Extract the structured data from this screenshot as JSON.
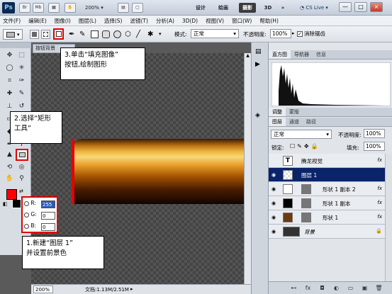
{
  "app": {
    "logo": "Ps",
    "zoom": "200%",
    "workspaces": [
      "设计",
      "绘画",
      "摄影",
      "3D"
    ],
    "active_workspace": "摄影",
    "cs_live": "CS Live",
    "window_buttons": [
      "—",
      "□",
      "×"
    ]
  },
  "menu": {
    "items": [
      "文件(F)",
      "编辑(E)",
      "图像(I)",
      "图层(L)",
      "选择(S)",
      "滤镜(T)",
      "分析(A)",
      "3D(D)",
      "视图(V)",
      "窗口(W)",
      "帮助(H)"
    ]
  },
  "options": {
    "mode_label": "模式:",
    "mode_value": "正常",
    "opacity_label": "不透明度:",
    "opacity_value": "100%",
    "antialias_label": "消除锯齿",
    "antialias_checked": true
  },
  "document": {
    "tab_label": "按钮背景",
    "status_zoom": "200%",
    "status_doc": "文档:1.13M/2.51M"
  },
  "colors": {
    "foreground": "#ff0000",
    "background": "#000000",
    "highlight": "#e00000"
  },
  "color_picker": {
    "r_label": "R:",
    "r_value": "255",
    "g_label": "G:",
    "g_value": "0",
    "b_label": "B:",
    "b_value": "0"
  },
  "panels": {
    "top_tabs": [
      "直方图",
      "导航器",
      "信息"
    ],
    "mid_tabs": [
      "调整",
      "蒙版"
    ],
    "layer_tabs": [
      "图层",
      "通道",
      "路径"
    ]
  },
  "layers": {
    "blend_mode": "正常",
    "opacity_label": "不透明度:",
    "opacity": "100%",
    "lock_label": "锁定:",
    "fill_label": "填充:",
    "fill": "100%",
    "rows": [
      {
        "name": "腾龙视觉",
        "type": "text",
        "fx": "fx",
        "selected": false
      },
      {
        "name": "图层 1",
        "type": "empty",
        "fx": "",
        "selected": true
      },
      {
        "name": "形状 1 副本 2",
        "type": "shape-white",
        "fx": "fx",
        "selected": false
      },
      {
        "name": "形状 1 副本",
        "type": "shape-black",
        "fx": "fx",
        "selected": false
      },
      {
        "name": "形状 1",
        "type": "shape-brown",
        "fx": "fx",
        "selected": false
      },
      {
        "name": "背景",
        "type": "background",
        "fx": "",
        "selected": false
      }
    ]
  },
  "callouts": {
    "step3_line1": "3.单击“填充图像”",
    "step3_line2": "按钮,绘制图形",
    "step2_line1": "2.选择“矩形",
    "step2_line2": "工具”",
    "step1_line1": "1.新建“图层  1”",
    "step1_line2": "并设置前景色"
  }
}
